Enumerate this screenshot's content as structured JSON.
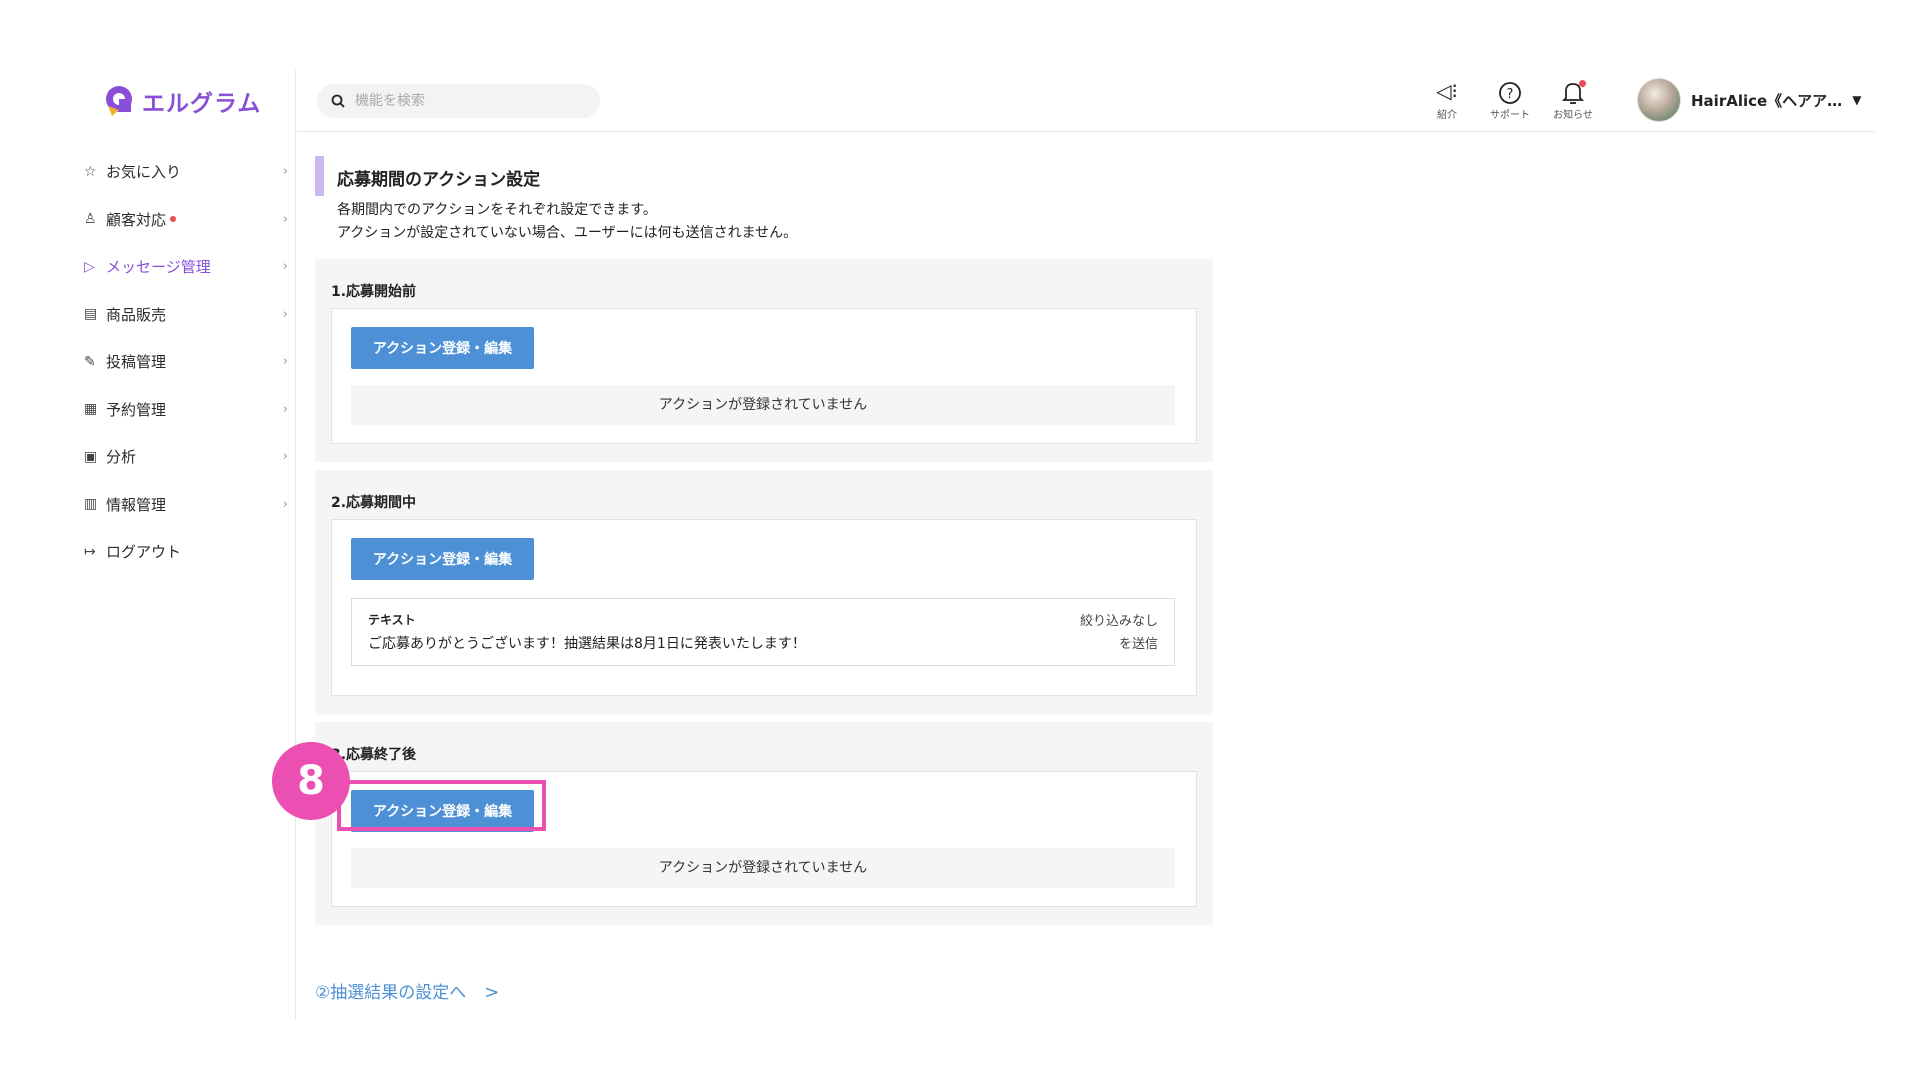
{
  "brand": {
    "name": "エルグラム",
    "color": "#8a4fd8"
  },
  "sidebar": {
    "items": [
      {
        "label": "お気に入り",
        "icon": "star-icon"
      },
      {
        "label": "顧客対応",
        "icon": "user-icon",
        "badge": true
      },
      {
        "label": "メッセージ管理",
        "icon": "send-icon",
        "active": true
      },
      {
        "label": "商品販売",
        "icon": "store-icon"
      },
      {
        "label": "投稿管理",
        "icon": "edit-icon"
      },
      {
        "label": "予約管理",
        "icon": "calendar-icon"
      },
      {
        "label": "分析",
        "icon": "report-icon"
      },
      {
        "label": "情報管理",
        "icon": "chart-icon"
      },
      {
        "label": "ログアウト",
        "icon": "logout-icon"
      }
    ]
  },
  "header": {
    "search_placeholder": "機能を検索",
    "icons": [
      {
        "label": "紹介",
        "icon": "megaphone-icon"
      },
      {
        "label": "サポート",
        "icon": "help-icon"
      },
      {
        "label": "お知らせ",
        "icon": "bell-icon"
      }
    ],
    "user_name": "HairAlice《ヘアア…"
  },
  "main": {
    "title": "応募期間のアクション設定",
    "desc_line1": "各期間内でのアクションをそれぞれ設定できます。",
    "desc_line2": "アクションが設定されていない場合、ユーザーには何も送信されません。",
    "sections": [
      {
        "label": "1.応募開始前",
        "button": "アクション登録・編集",
        "empty_text": "アクションが登録されていません"
      },
      {
        "label": "2.応募期間中",
        "button": "アクション登録・編集",
        "message": {
          "type": "テキスト",
          "body": "ご応募ありがとうございます！抽選結果は8月1日に発表いたします！",
          "filter": "絞り込みなし",
          "action": "を送信"
        }
      },
      {
        "label": "3.応募終了後",
        "button": "アクション登録・編集",
        "empty_text": "アクションが登録されていません"
      }
    ],
    "next_link": "②抽選結果の設定へ",
    "next_arrow": ">"
  },
  "annotation": {
    "step_number": "8",
    "color": "#ea4fb1"
  },
  "colors": {
    "primary_button": "#4d90d6",
    "accent": "#8a4fd8",
    "notification": "#e94b5a"
  }
}
